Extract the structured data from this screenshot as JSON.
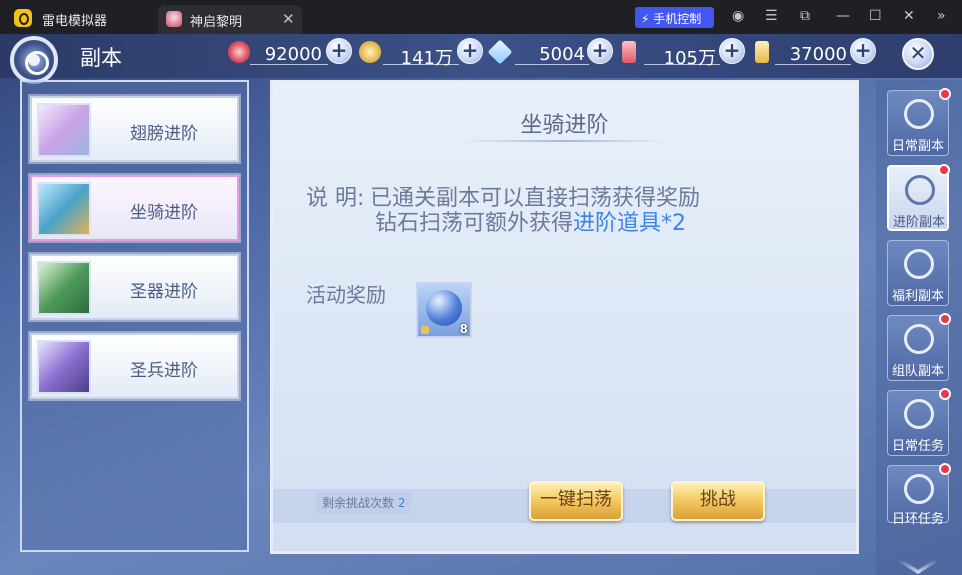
{
  "titlebar": {
    "app_name": "雷电模拟器",
    "tab_title": "神启黎明",
    "tab_close": "✕",
    "phone_control": "手机控制"
  },
  "header": {
    "title": "副本",
    "close": "✕",
    "plus": "+"
  },
  "currencies": [
    {
      "icon": "red-orb-icon",
      "value": "92000",
      "color": "#d94a5a"
    },
    {
      "icon": "gold-coin-icon",
      "value": "141万",
      "color": "#e2b84a"
    },
    {
      "icon": "diamond-icon",
      "value": "5004",
      "color": "#8fc8ff"
    },
    {
      "icon": "red-crystal-icon",
      "value": "105万",
      "color": "#e15a66"
    },
    {
      "icon": "gold-crystal-icon",
      "value": "37000",
      "color": "#e7b84c"
    }
  ],
  "categories": [
    {
      "label": "翅膀进阶",
      "icon": "wings-icon",
      "selected": false
    },
    {
      "label": "坐骑进阶",
      "icon": "dragon-mount-icon",
      "selected": true
    },
    {
      "label": "圣器进阶",
      "icon": "holy-artifact-icon",
      "selected": false
    },
    {
      "label": "圣兵进阶",
      "icon": "holy-weapon-icon",
      "selected": false
    }
  ],
  "main": {
    "title": "坐骑进阶",
    "desc_label": "说  明:",
    "desc_line1": "已通关副本可以直接扫荡获得奖励",
    "desc_line2_prefix": "钻石扫荡可额外获得",
    "desc_line2_highlight": "进阶道具*2",
    "reward_label": "活动奖励",
    "reward_count": "8",
    "remaining_label": "剩余挑战次数",
    "remaining_value": "2",
    "sweep_button": "一键扫荡",
    "challenge_button": "挑战"
  },
  "sidebar": [
    {
      "label": "日常副本",
      "icon": "book-icon",
      "selected": false,
      "dot": true
    },
    {
      "label": "进阶副本",
      "icon": "open-book-icon",
      "selected": true,
      "dot": true
    },
    {
      "label": "福利副本",
      "icon": "welfare-icon",
      "selected": false,
      "dot": false
    },
    {
      "label": "组队副本",
      "icon": "team-icon",
      "selected": false,
      "dot": true
    },
    {
      "label": "日常任务",
      "icon": "shield-icon",
      "selected": false,
      "dot": true
    },
    {
      "label": "日环任务",
      "icon": "cross-shield-icon",
      "selected": false,
      "dot": true
    }
  ]
}
